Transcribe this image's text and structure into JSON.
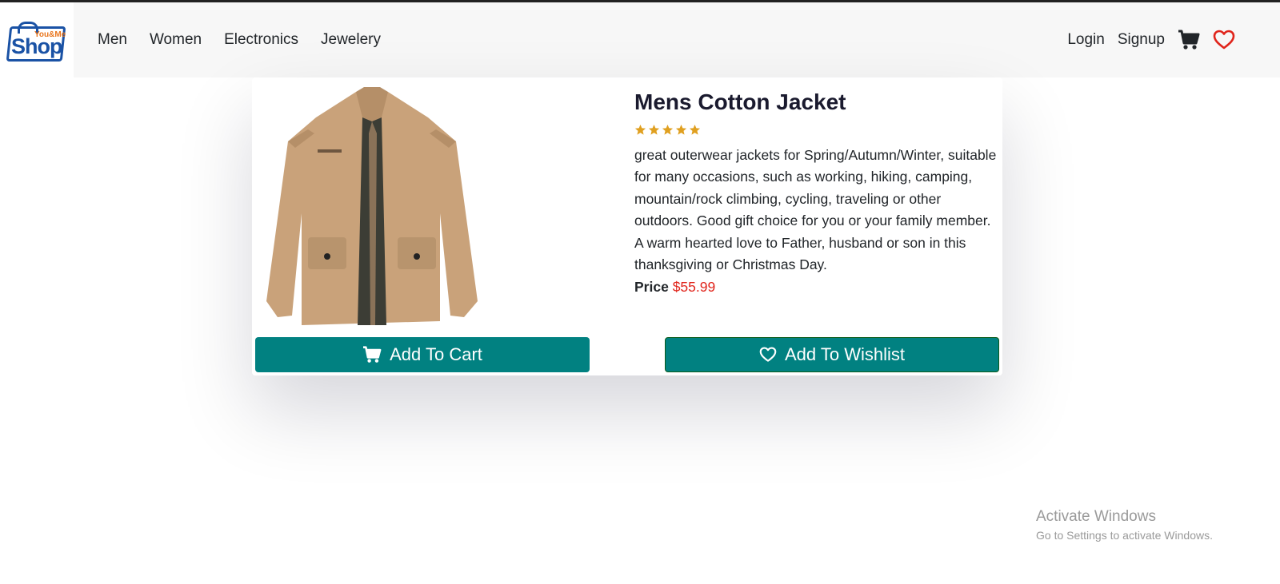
{
  "brand": {
    "logo_top": "You&Me",
    "logo_main": "Shop"
  },
  "nav": {
    "links": [
      "Men",
      "Women",
      "Electronics",
      "Jewelery"
    ],
    "login": "Login",
    "signup": "Signup",
    "cart_icon": "cart-icon",
    "wishlist_icon": "heart-icon"
  },
  "product": {
    "title": "Mens Cotton Jacket",
    "rating_stars": 5,
    "description": "great outerwear jackets for Spring/Autumn/Winter, suitable for many occasions, such as working, hiking, camping, mountain/rock climbing, cycling, traveling or other outdoors. Good gift choice for you or your family member. A warm hearted love to Father, husband or son in this thanksgiving or Christmas Day.",
    "price_label": "Price",
    "price_value": "$55.99"
  },
  "actions": {
    "add_to_cart": "Add To Cart",
    "add_to_wishlist": "Add To Wishlist"
  },
  "watermark": {
    "line1": "Activate Windows",
    "line2": "Go to Settings to activate Windows."
  },
  "colors": {
    "accent": "#018181",
    "price": "#e0241b",
    "star": "#e0a020",
    "heart": "#e0241b"
  }
}
